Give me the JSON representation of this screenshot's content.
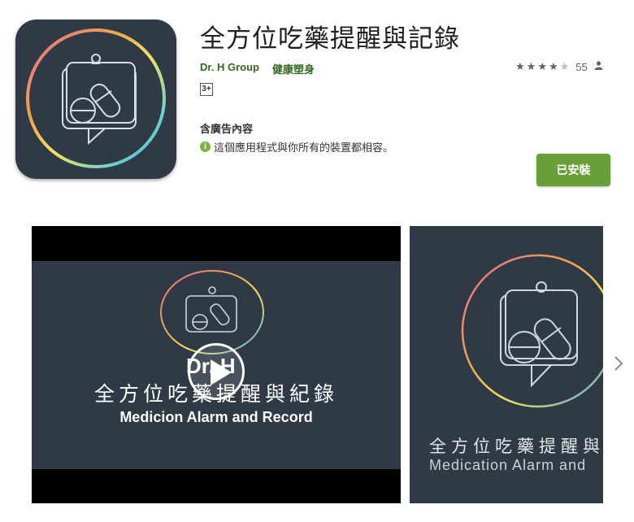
{
  "app": {
    "title": "全方位吃藥提醒與記錄",
    "developer": "Dr. H Group",
    "category": "健康塑身",
    "rating": {
      "stars": [
        "★",
        "★",
        "★",
        "★",
        "★"
      ],
      "value": 4.2,
      "count": "55"
    },
    "content_rating": "3+",
    "contains_ads": "含廣告內容",
    "compatibility": "這個應用程式與你所有的裝置都相容。",
    "install_label": "已安裝"
  },
  "icon_glyphs": {
    "info": "i"
  },
  "icons": [
    "app-icon",
    "star-icon",
    "person-icon",
    "info-icon",
    "play-icon",
    "chevron-right-icon"
  ],
  "screenshots": [
    {
      "type": "video",
      "overlay_logo": "Dr. H",
      "title_zh": "全方位吃藥提醒與紀錄",
      "title_en": "Medicion Alarm and Record"
    },
    {
      "type": "image",
      "title_zh": "全方位吃藥提醒與",
      "title_en": "Medication Alarm and"
    }
  ],
  "colors": {
    "accent_green": "#689f38",
    "developer_green": "#33691e",
    "icon_background": "#2f3a46"
  }
}
